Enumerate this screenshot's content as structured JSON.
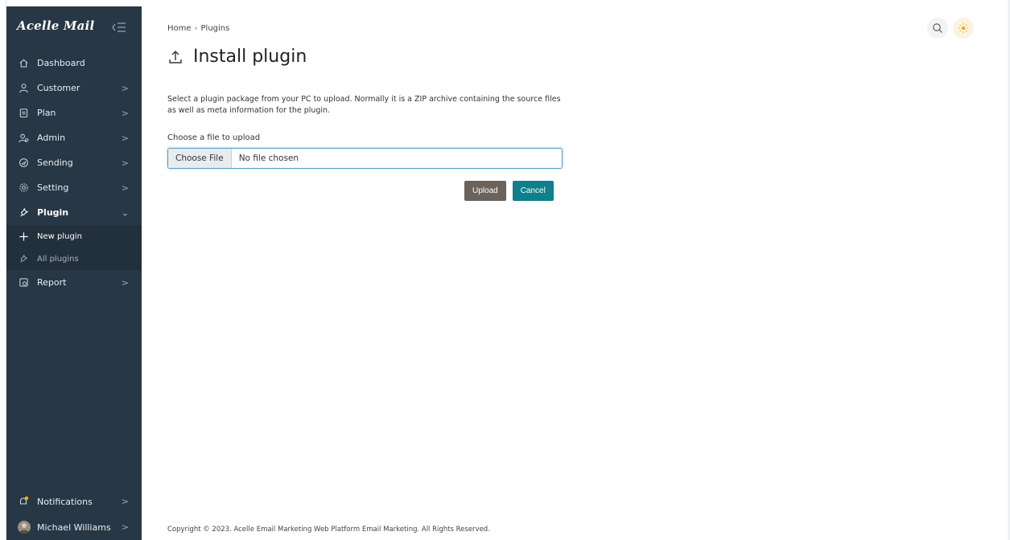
{
  "brand": {
    "name": "Acelle Mail"
  },
  "sidebar": {
    "items": [
      {
        "label": "Dashboard",
        "icon": "home-icon",
        "has_chevron": false
      },
      {
        "label": "Customer",
        "icon": "user-icon",
        "has_chevron": true
      },
      {
        "label": "Plan",
        "icon": "clipboard-icon",
        "has_chevron": true
      },
      {
        "label": "Admin",
        "icon": "admin-icon",
        "has_chevron": true
      },
      {
        "label": "Sending",
        "icon": "sending-icon",
        "has_chevron": true
      },
      {
        "label": "Setting",
        "icon": "gear-icon",
        "has_chevron": true
      },
      {
        "label": "Plugin",
        "icon": "plug-icon",
        "has_chevron": true,
        "expanded": true
      }
    ],
    "plugin_sub": [
      {
        "label": "New plugin",
        "icon": "plus-icon",
        "active": true
      },
      {
        "label": "All plugins",
        "icon": "plug-icon",
        "active": false
      }
    ],
    "after_items": [
      {
        "label": "Report",
        "icon": "report-icon",
        "has_chevron": true
      }
    ],
    "bottom": {
      "notifications": "Notifications",
      "user": "Michael Williams"
    },
    "chevron": ">"
  },
  "breadcrumb": {
    "home": "Home",
    "sep": "›",
    "current": "Plugins"
  },
  "page": {
    "title": "Install plugin",
    "description": "Select a plugin package from your PC to upload. Normally it is a ZIP archive containing the source files as well as meta information for the plugin.",
    "file_label": "Choose a file to upload",
    "file_button": "Choose File",
    "file_status": "No file chosen",
    "upload_label": "Upload",
    "cancel_label": "Cancel"
  },
  "footer": {
    "text": "Copyright © 2023. Acelle Email Marketing Web Platform Email Marketing. All Rights Reserved."
  },
  "colors": {
    "sidebar_bg": "#283745",
    "upload_btn": "#6b625c",
    "cancel_btn": "#0f7f8c",
    "notification_dot": "#f5b400"
  }
}
